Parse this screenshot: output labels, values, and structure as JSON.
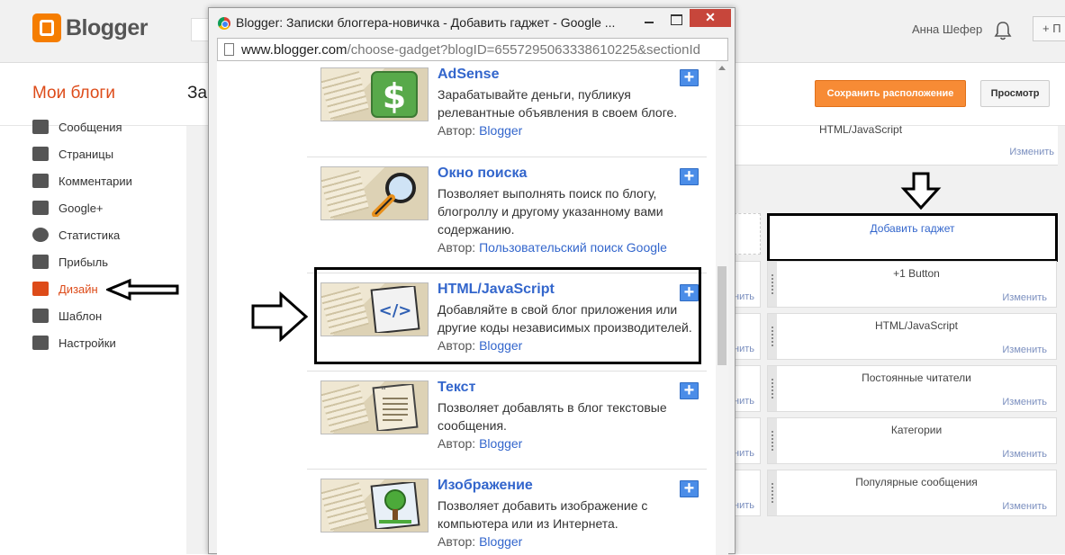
{
  "header": {
    "logo_text": "Blogger",
    "user_name": "Анна Шефер",
    "new_button": "+ П"
  },
  "subheader": {
    "my_blogs": "Мои блоги",
    "blog_title_fragment": "Заг",
    "save_button": "Сохранить расположение",
    "preview_button": "Просмотр"
  },
  "sidebar": {
    "items": [
      {
        "label": "Сообщения",
        "icon": "posts-icon"
      },
      {
        "label": "Страницы",
        "icon": "pages-icon"
      },
      {
        "label": "Комментарии",
        "icon": "comments-icon"
      },
      {
        "label": "Google+",
        "icon": "google-plus-icon"
      },
      {
        "label": "Статистика",
        "icon": "stats-icon"
      },
      {
        "label": "Прибыль",
        "icon": "earnings-icon"
      },
      {
        "label": "Дизайн",
        "icon": "layout-icon",
        "active": true
      },
      {
        "label": "Шаблон",
        "icon": "template-icon"
      },
      {
        "label": "Настройки",
        "icon": "settings-icon"
      }
    ]
  },
  "layout": {
    "top_widget_title": "HTML/JavaScript",
    "edit_label": "Изменить",
    "add_gadget": "Добавить гаджет",
    "widgets": [
      {
        "title": "+1 Button"
      },
      {
        "title": "HTML/JavaScript"
      },
      {
        "title": "Постоянные читатели"
      },
      {
        "title": "Категории"
      },
      {
        "title": "Популярные сообщения"
      }
    ],
    "stub_label": "нить"
  },
  "popup": {
    "title": "Blogger: Записки блоггера-новичка - Добавить гаджет - Google ...",
    "close_label": "✕",
    "url_host": "www.blogger.com",
    "url_path": "/choose-gadget?blogID=6557295063338610225&sectionId",
    "author_label": "Автор:",
    "add_button": "+",
    "gadgets": [
      {
        "name": "AdSense",
        "description": "Зарабатывайте деньги, публикуя релевантные объявления в своем блоге.",
        "author": "Blogger",
        "icon": "dollar-icon"
      },
      {
        "name": "Окно поиска",
        "description": "Позволяет выполнять поиск по блогу, блогроллу и другому указанному вами содержанию.",
        "author": "Пользовательский поиск Google",
        "icon": "magnifier-icon"
      },
      {
        "name": "HTML/JavaScript",
        "description": "Добавляйте в свой блог приложения или другие коды независимых производителей.",
        "author": "Blogger",
        "icon": "code-icon"
      },
      {
        "name": "Текст",
        "description": "Позволяет добавлять в блог текстовые сообщения.",
        "author": "Blogger",
        "icon": "text-icon"
      },
      {
        "name": "Изображение",
        "description": "Позволяет добавить изображение с компьютера или из Интернета.",
        "author": "Blogger",
        "icon": "image-icon"
      }
    ]
  }
}
